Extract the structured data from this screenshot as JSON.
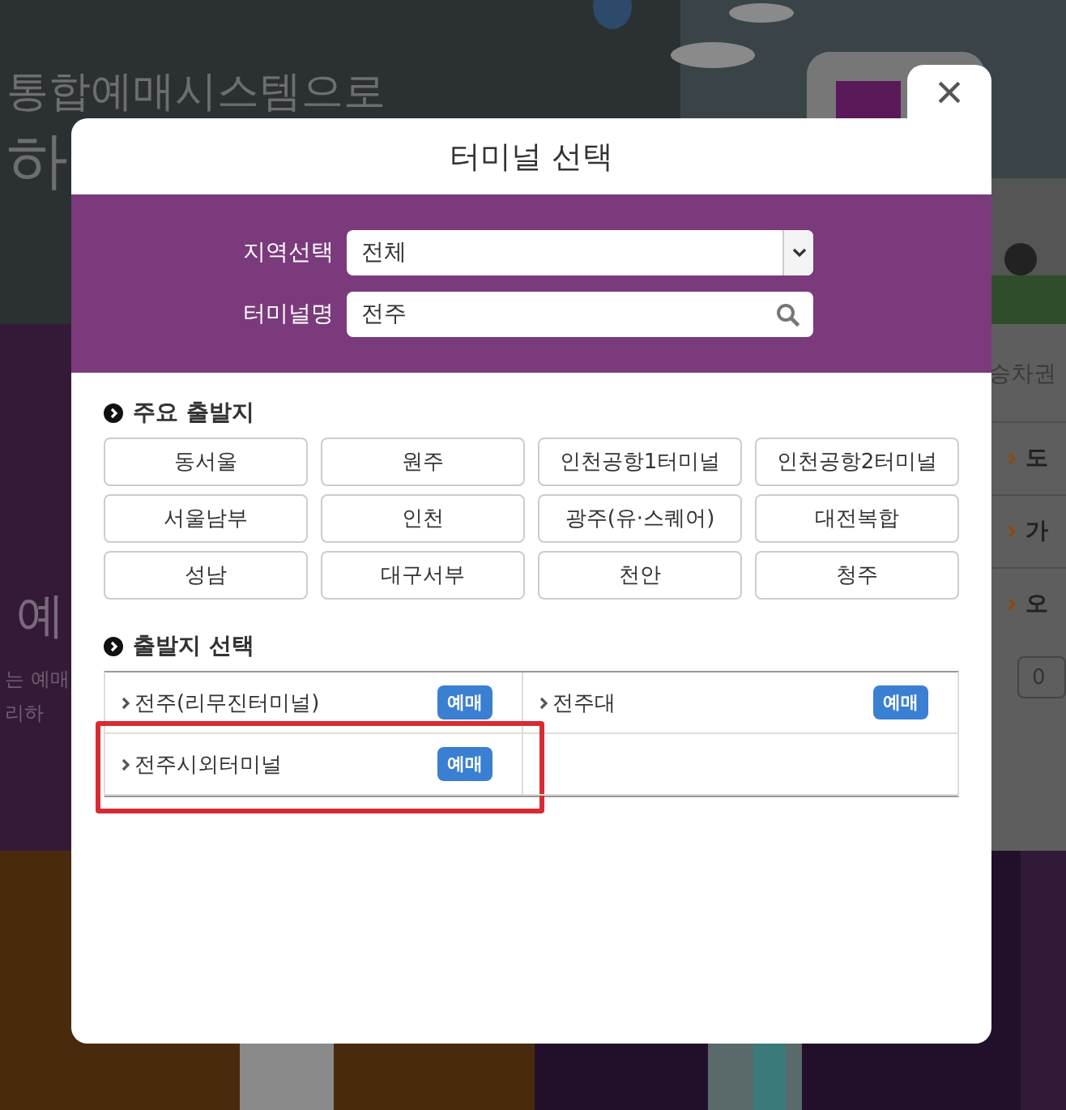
{
  "background_page": {
    "hero_lines": [
      "통합예매시스템으로",
      "하"
    ],
    "side_heading": "예",
    "side_lines": [
      "는 예매",
      "리하"
    ],
    "panel_title": "승차권",
    "panel_rows": [
      "도",
      "가",
      "오"
    ],
    "panel_count": "0"
  },
  "dialog": {
    "title": "터미널 선택",
    "close_label": "×",
    "filters": [
      {
        "kind": "select",
        "label": "지역선택",
        "value": "전체"
      },
      {
        "kind": "search",
        "label": "터미널명",
        "value": "전주"
      }
    ],
    "major_title": "주요 출발지",
    "major_terminals": [
      "동서울",
      "원주",
      "인천공항1터미널",
      "인천공항2터미널",
      "서울남부",
      "인천",
      "광주(유·스퀘어)",
      "대전복합",
      "성남",
      "대구서부",
      "천안",
      "청주"
    ],
    "results_title": "출발지 선택",
    "results": [
      {
        "name": "전주(리무진터미널)",
        "action": "예매",
        "highlighted": false
      },
      {
        "name": "전주대",
        "action": "예매",
        "highlighted": false
      },
      {
        "name": "전주시외터미널",
        "action": "예매",
        "highlighted": true
      }
    ]
  }
}
